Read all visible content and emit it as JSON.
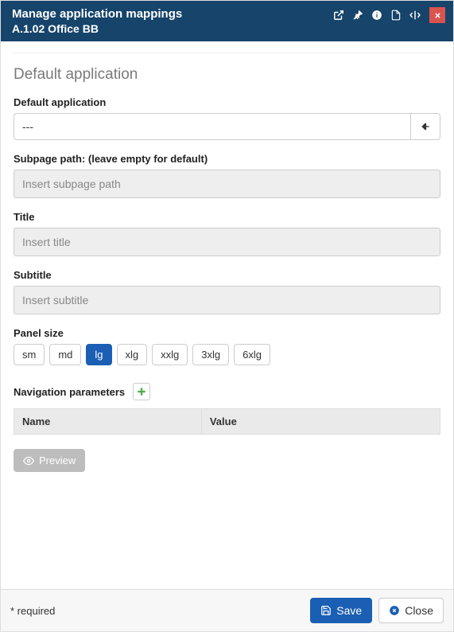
{
  "header": {
    "title": "Manage application mappings",
    "subtitle": "A.1.02 Office BB"
  },
  "section": {
    "heading": "Default application"
  },
  "form": {
    "default_app_label": "Default application",
    "default_app_value": "---",
    "subpage_label": "Subpage path: (leave empty for default)",
    "subpage_placeholder": "Insert subpage path",
    "title_label": "Title",
    "title_placeholder": "Insert title",
    "subtitle_label": "Subtitle",
    "subtitle_placeholder": "Insert subtitle",
    "panel_size_label": "Panel size",
    "sizes": {
      "sm": "sm",
      "md": "md",
      "lg": "lg",
      "xlg": "xlg",
      "xxlg": "xxlg",
      "3xlg": "3xlg",
      "6xlg": "6xlg"
    },
    "nav_params_label": "Navigation parameters",
    "table": {
      "col_name": "Name",
      "col_value": "Value"
    },
    "preview_label": "Preview"
  },
  "footer": {
    "required_hint": "* required",
    "save_label": "Save",
    "close_label": "Close"
  }
}
